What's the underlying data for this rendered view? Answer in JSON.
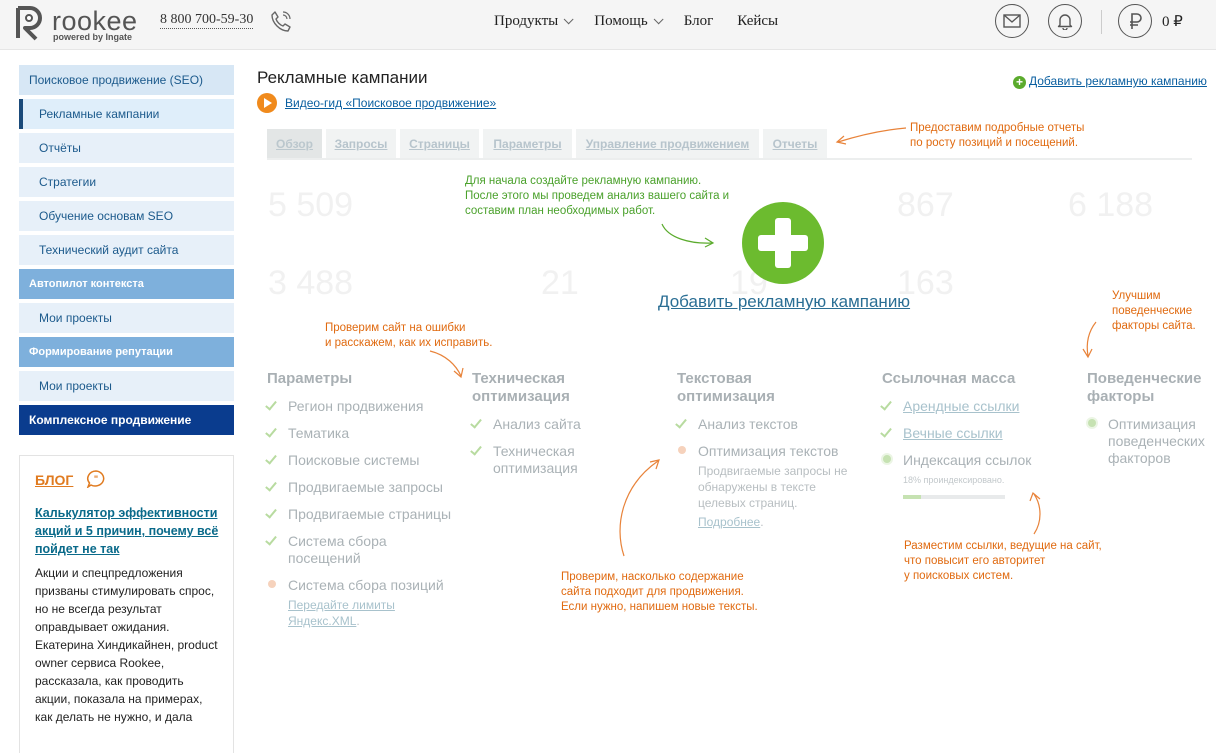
{
  "header": {
    "logo_word": "rookee",
    "logo_sub": "powered by Ingate",
    "phone": "8 800 700-59-30",
    "nav": [
      {
        "label": "Продукты",
        "has_dropdown": true
      },
      {
        "label": "Помощь",
        "has_dropdown": true
      },
      {
        "label": "Блог",
        "has_dropdown": false
      },
      {
        "label": "Кейсы",
        "has_dropdown": false
      }
    ],
    "balance": "0 ₽",
    "icons": [
      "mail-icon",
      "bell-icon",
      "ruble-icon",
      "phone-icon"
    ]
  },
  "sidebar": {
    "items": [
      {
        "label": "Поисковое продвижение (SEO)",
        "type": "section"
      },
      {
        "label": "Рекламные кампании",
        "type": "item",
        "active": true
      },
      {
        "label": "Отчёты",
        "type": "item"
      },
      {
        "label": "Стратегии",
        "type": "item"
      },
      {
        "label": "Обучение основам SEO",
        "type": "item"
      },
      {
        "label": "Технический аудит сайта",
        "type": "item"
      },
      {
        "label": "Автопилот контекста",
        "type": "section"
      },
      {
        "label": "Мои проекты",
        "type": "item"
      },
      {
        "label": "Формирование репутации",
        "type": "section"
      },
      {
        "label": "Мои проекты",
        "type": "item"
      },
      {
        "label": "Комплексное продвижение",
        "type": "dark"
      }
    ]
  },
  "blog": {
    "title": "БЛОГ",
    "link": "Калькулятор эффективности акций и 5 причин, почему всё пойдет не так",
    "text": "Акции и спецпредложения призваны стимулировать спрос, но не всегда результат оправдывает ожидания. Екатерина Хиндикайнен, product owner сервиса Rookee, рассказала, как проводить акции, показала на примерах, как делать не нужно, и дала"
  },
  "main": {
    "title": "Рекламные кампании",
    "video_link": "Видео-гид «Поисковое продвижение»",
    "add_campaign_top": "Добавить рекламную кампанию",
    "add_campaign_main": "Добавить рекламную кампанию",
    "tabs": [
      "Обзор",
      "Запросы",
      "Страницы",
      "Параметры",
      "Управление продвижением",
      "Отчеты"
    ],
    "ghost_numbers": [
      "5 509",
      "867",
      "6 188",
      "3 488",
      "21",
      "19",
      "163"
    ]
  },
  "annotations": {
    "reports": "Предоставим подробные отчеты\nпо росту позиций и посещений.",
    "create": "Для начала создайте рекламную кампанию.\nПосле этого мы проведем анализ вашего сайта и\nсоставим план необходимых работ.",
    "errors": "Проверим сайт на ошибки\nи расскажем, как их исправить.",
    "behavior": "Улучшим\nповеденческие\nфакторы сайта.",
    "content": "Проверим, насколько содержание\nсайта подходит для продвижения.\nЕсли нужно, напишем новые тексты.",
    "links": "Разместим ссылки, ведущие на сайт,\nчто повысит его авторитет\nу поисковых систем."
  },
  "columns": [
    {
      "title": "Параметры",
      "features": [
        {
          "label": "Регион продвижения",
          "status": "done"
        },
        {
          "label": "Тематика",
          "status": "done"
        },
        {
          "label": "Поисковые системы",
          "status": "done"
        },
        {
          "label": "Продвигаемые запросы",
          "status": "done"
        },
        {
          "label": "Продвигаемые страницы",
          "status": "done"
        },
        {
          "label": "Система сбора посещений",
          "status": "done"
        },
        {
          "label": "Система сбора позиций",
          "status": "pending",
          "link": "Передайте лимиты Яндекс.XML"
        }
      ]
    },
    {
      "title": "Техническая оптимизация",
      "features": [
        {
          "label": "Анализ сайта",
          "status": "done"
        },
        {
          "label": "Техническая оптимизация",
          "status": "done"
        }
      ]
    },
    {
      "title": "Текстовая оптимизация",
      "features": [
        {
          "label": "Анализ текстов",
          "status": "done"
        },
        {
          "label": "Оптимизация текстов",
          "status": "pending",
          "note": "Продвигаемые запросы не обнаружены в тексте целевых страниц.",
          "link": "Подробнее"
        }
      ]
    },
    {
      "title": "Ссылочная масса",
      "features": [
        {
          "label": "Арендные ссылки",
          "status": "done",
          "is_link": true
        },
        {
          "label": "Вечные ссылки",
          "status": "done",
          "is_link": true
        },
        {
          "label": "Индексация ссылок",
          "status": "progress",
          "progress_label": "18% проиндексировано.",
          "progress": 0.18
        }
      ]
    },
    {
      "title": "Поведенческие факторы",
      "features": [
        {
          "label": "Оптимизация поведенческих факторов",
          "status": "progress"
        }
      ]
    }
  ]
}
